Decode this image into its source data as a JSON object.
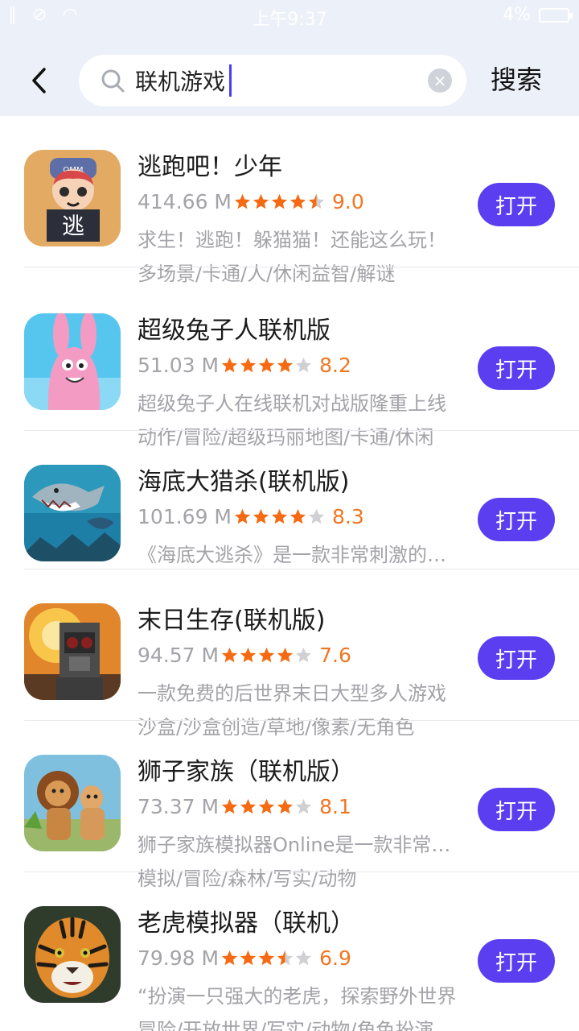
{
  "status_bar": {
    "time": "上午9:37",
    "battery": "4%"
  },
  "header": {
    "back_label": "<",
    "search_query": "联机游戏",
    "clear_label": "×",
    "search_button": "搜索"
  },
  "colors": {
    "accent": "#5a3ef0",
    "star": "#f56a12",
    "rating": "#f07622",
    "muted": "#a3a3a8"
  },
  "apps": [
    {
      "name": "逃跑吧！少年",
      "size": "414.66 M",
      "rating": "9.0",
      "stars": 4.5,
      "description": "求生！逃跑！躲猫猫！还能这么玩！",
      "tags": "多场景/卡通/人/休闲益智/解谜",
      "action": "打开"
    },
    {
      "name": "超级兔子人联机版",
      "size": "51.03 M",
      "rating": "8.2",
      "stars": 4,
      "description": "超级兔子人在线联机对战版隆重上线",
      "tags": "动作/冒险/超级玛丽地图/卡通/休闲",
      "action": "打开"
    },
    {
      "name": "海底大猎杀(联机版)",
      "size": "101.69 M",
      "rating": "8.3",
      "stars": 4,
      "description": "《海底大逃杀》是一款非常刺激的游戏",
      "tags": "",
      "action": "打开"
    },
    {
      "name": "末日生存(联机版)",
      "size": "94.57 M",
      "rating": "7.6",
      "stars": 4,
      "description": "一款免费的后世界末日大型多人游戏",
      "tags": "沙盒/沙盒创造/草地/像素/无角色",
      "action": "打开"
    },
    {
      "name": "狮子家族（联机版）",
      "size": "73.37 M",
      "rating": "8.1",
      "stars": 4,
      "description": "狮子家族模拟器Online是一款非常好玩",
      "tags": "模拟/冒险/森林/写实/动物",
      "action": "打开"
    },
    {
      "name": "老虎模拟器（联机）",
      "size": "79.98 M",
      "rating": "6.9",
      "stars": 3.5,
      "description": "“扮演一只强大的老虎，探索野外世界",
      "tags": "冒险/开放世界/写实/动物/角色扮演",
      "action": "打开"
    }
  ]
}
